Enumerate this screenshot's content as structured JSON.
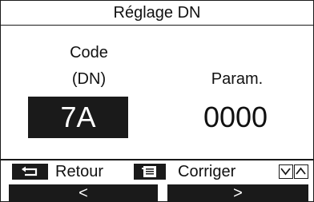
{
  "title": "Réglage DN",
  "code_label_line1": "Code",
  "code_label_line2": "(DN)",
  "param_label": "Param.",
  "code_value": "7A",
  "param_value": "0000",
  "footer": {
    "back_label": "Retour",
    "correct_label": "Corriger",
    "back_icon": "return-arrow-icon",
    "menu_icon": "menu-icon",
    "down_icon": "chevron-down-icon",
    "up_icon": "chevron-up-icon"
  },
  "nav": {
    "left_label": "<",
    "right_label": ">"
  },
  "colors": {
    "foreground": "#1a1a1a",
    "background": "#ffffff"
  }
}
